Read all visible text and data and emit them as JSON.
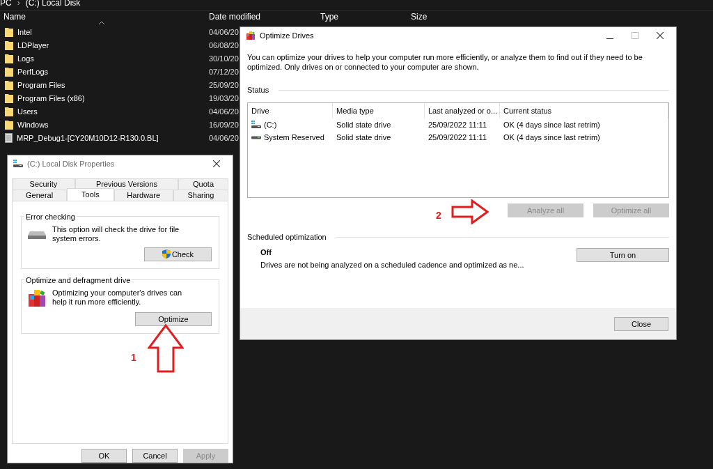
{
  "explorer": {
    "breadcrumb": [
      "PC",
      "›",
      "(C:) Local Disk"
    ],
    "columns": [
      "Name",
      "Date modified",
      "Type",
      "Size"
    ],
    "rows": [
      {
        "kind": "folder",
        "name": "Intel",
        "date": "04/06/20"
      },
      {
        "kind": "folder",
        "name": "LDPlayer",
        "date": "06/08/20"
      },
      {
        "kind": "folder",
        "name": "Logs",
        "date": "30/10/20"
      },
      {
        "kind": "folder",
        "name": "PerfLogs",
        "date": "07/12/20"
      },
      {
        "kind": "folder",
        "name": "Program Files",
        "date": "25/09/20"
      },
      {
        "kind": "folder",
        "name": "Program Files (x86)",
        "date": "19/03/20"
      },
      {
        "kind": "folder",
        "name": "Users",
        "date": "04/06/20"
      },
      {
        "kind": "folder",
        "name": "Windows",
        "date": "16/09/20"
      },
      {
        "kind": "file",
        "name": "MRP_Debug1-[CY20M10D12-R130.0.BL]",
        "date": "04/06/20"
      }
    ]
  },
  "properties": {
    "title": "(C:) Local Disk Properties",
    "tab_rows": [
      [
        {
          "label": "Security",
          "selected": false
        },
        {
          "label": "Previous Versions",
          "selected": false
        },
        {
          "label": "Quota",
          "selected": false
        }
      ],
      [
        {
          "label": "General",
          "selected": false
        },
        {
          "label": "Tools",
          "selected": true
        },
        {
          "label": "Hardware",
          "selected": false
        },
        {
          "label": "Sharing",
          "selected": false
        }
      ]
    ],
    "groups": [
      {
        "kind": "check",
        "title": "Error checking",
        "text": "This option will check the drive for file system errors.",
        "button": "Check"
      },
      {
        "kind": "optimize",
        "title": "Optimize and defragment drive",
        "text": "Optimizing your computer's drives can help it run more efficiently.",
        "button": "Optimize"
      }
    ],
    "buttons": [
      {
        "label": "OK",
        "disabled": false
      },
      {
        "label": "Cancel",
        "disabled": false
      },
      {
        "label": "Apply",
        "disabled": true
      }
    ]
  },
  "optimize": {
    "title": "Optimize Drives",
    "description": "You can optimize your drives to help your computer run more efficiently, or analyze them to find out if they need to be optimized. Only drives on or connected to your computer are shown.",
    "status_label": "Status",
    "columns": [
      "Drive",
      "Media type",
      "Last analyzed or o...",
      "Current status"
    ],
    "drives": [
      {
        "kind": "system",
        "name": "(C:)",
        "media": "Solid state drive",
        "last": "25/09/2022 11:11",
        "status": "OK (4 days since last retrim)"
      },
      {
        "kind": "plain",
        "name": "System Reserved",
        "media": "Solid state drive",
        "last": "25/09/2022 11:11",
        "status": "OK (4 days since last retrim)"
      }
    ],
    "actions": [
      {
        "label": "Analyze all",
        "disabled": true
      },
      {
        "label": "Optimize all",
        "disabled": true
      }
    ],
    "schedule_label": "Scheduled optimization",
    "schedule_state": "Off",
    "schedule_text": "Drives are not being analyzed on a scheduled cadence and optimized as ne...",
    "schedule_button": "Turn on",
    "close": "Close"
  },
  "annotations": [
    {
      "label": "1",
      "kind": "up"
    },
    {
      "label": "2",
      "kind": "right"
    }
  ]
}
